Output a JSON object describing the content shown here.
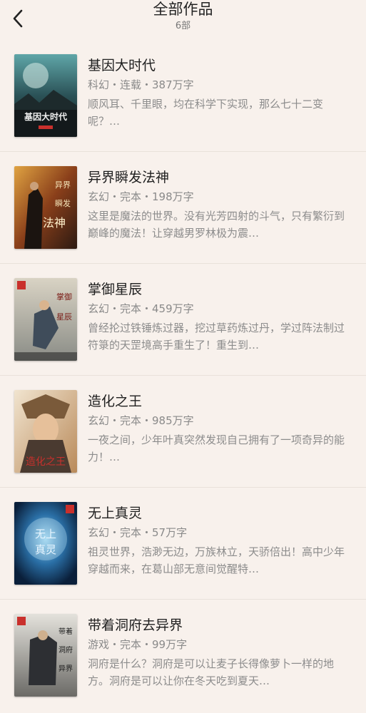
{
  "header": {
    "title": "全部作品",
    "count": "6部"
  },
  "books": [
    {
      "title": "基因大时代",
      "meta": "科幻・连载・387万字",
      "desc": "顺风耳、千里眼，均在科学下实现，那么七十二变呢？…",
      "cover_text": "基因大时代",
      "cover_icon": "cover-sci-fi"
    },
    {
      "title": "异界瞬发法神",
      "meta": "玄幻・完本・198万字",
      "desc": "这里是魔法的世界。没有光芳四射的斗气，只有繁衍到巅峰的魔法！让穿越男罗林极为震…",
      "cover_text": "异界瞬发法神",
      "cover_icon": "cover-mage"
    },
    {
      "title": "掌御星辰",
      "meta": "玄幻・完本・459万字",
      "desc": "曾经抡过铁锤炼过器，挖过草药炼过丹，学过阵法制过符箓的天罡境高手重生了！重生到…",
      "cover_text": "掌御星辰",
      "cover_icon": "cover-warrior"
    },
    {
      "title": "造化之王",
      "meta": "玄幻・完本・985万字",
      "desc": "一夜之间，少年叶真突然发现自己拥有了一项奇异的能力！…",
      "cover_text": "造化之王",
      "cover_icon": "cover-portrait"
    },
    {
      "title": "无上真灵",
      "meta": "玄幻・完本・57万字",
      "desc": "祖灵世界，浩渺无边，万族林立，天骄倍出！高中少年穿越而来，在葛山部无意间觉醒特…",
      "cover_text": "无上真灵",
      "cover_icon": "cover-moon"
    },
    {
      "title": "带着洞府去异界",
      "meta": "游戏・完本・99万字",
      "desc": "洞府是什么？洞府是可以让麦子长得像萝卜一样的地方。洞府是可以让你在冬天吃到夏天…",
      "cover_text": "带着洞府去异界",
      "cover_icon": "cover-armor"
    }
  ]
}
